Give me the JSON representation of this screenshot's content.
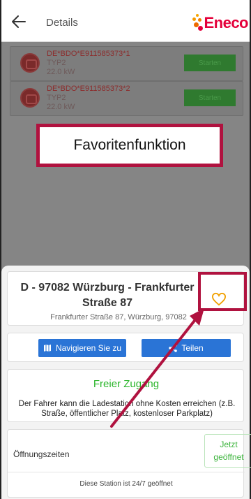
{
  "header": {
    "title": "Details",
    "logo_text": "Eneco",
    "back_icon": "arrow-left-icon"
  },
  "stations": [
    {
      "id": "DE*BDO*E911585373*1",
      "type": "TYP2",
      "power": "22.0 kW",
      "button": "Starten"
    },
    {
      "id": "DE*BDO*E911585373*2",
      "type": "TYP2",
      "power": "22.0 kW",
      "button": "Starten"
    }
  ],
  "callout": {
    "text": "Favoritenfunktion"
  },
  "address": {
    "title": "D - 97082 Würzburg - Frankfurter Straße 87",
    "subtitle": "Frankfurter Straße 87, Würzburg, 97082",
    "favorite_icon": "heart-outline-icon"
  },
  "actions": {
    "navigate_label": "Navigieren Sie zu",
    "share_label": "Teilen"
  },
  "access": {
    "title": "Freier Zugang",
    "description": "Der Fahrer kann die Ladestation ohne Kosten erreichen (z.B. Straße, öffentlicher Platz, kostenloser Parkplatz)"
  },
  "hours": {
    "label": "Öffnungszeiten",
    "badge_line1": "Jetzt",
    "badge_line2": "geöffnet",
    "note": "Diese Station ist 24/7 geöffnet"
  },
  "colors": {
    "brand": "#e4003a",
    "highlight": "#b0123f",
    "button_blue": "#2a74d6",
    "open_green": "#3cb43c",
    "heart_orange": "#f0a000"
  }
}
